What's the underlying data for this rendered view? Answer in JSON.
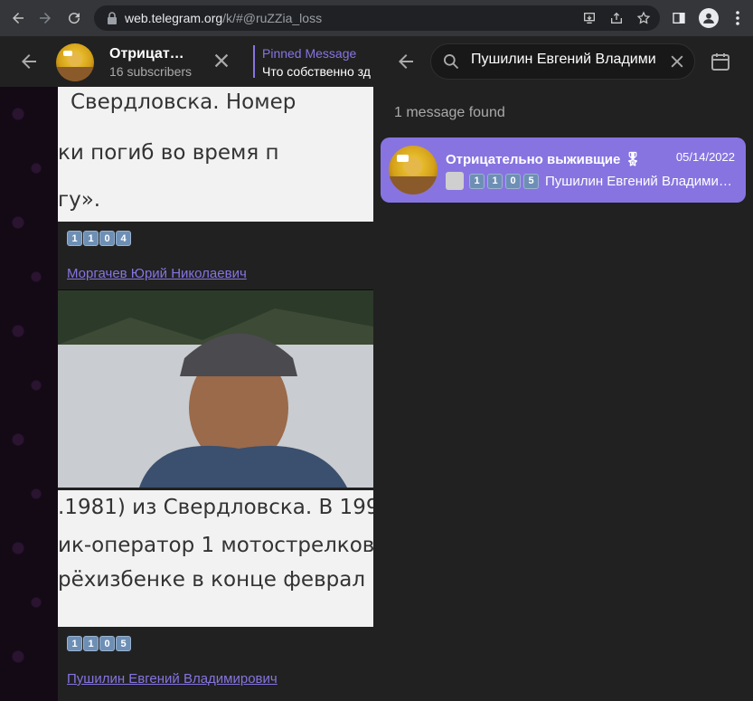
{
  "browser": {
    "url_host": "web.telegram.org",
    "url_path": "/k/#@ruZZia_loss"
  },
  "chat_header": {
    "title": "Отрицат…",
    "subscribers": "16 subscribers",
    "pinned_label": "Pinned Message",
    "pinned_text": "Что собственно зд"
  },
  "messages": [
    {
      "scan_lines": [
        "Свердловска. Номер",
        "ки погиб во время п",
        "гу»."
      ],
      "number_keys": [
        "1",
        "1",
        "0",
        "4"
      ],
      "link": "Моргачев Юрий Николаевич"
    },
    {
      "scan_lines": [
        ".1981) из Свердловска. В 199",
        "ик-оператор 1 мотострелково",
        "рёхизбенке в конце феврал"
      ],
      "number_keys": [
        "1",
        "1",
        "0",
        "5"
      ],
      "link": "Пушилин Евгений Владимирович"
    }
  ],
  "search": {
    "query": "Пушилин Евгений Владими",
    "results_count": "1 message found",
    "result": {
      "title": "Отрицательно выживщие",
      "badge": "🎖",
      "date": "05/14/2022",
      "number_keys": [
        "1",
        "1",
        "0",
        "5"
      ],
      "snippet": "Пушилин Евгений Владими…"
    }
  },
  "colors": {
    "accent": "#8774e1",
    "panel": "#212121",
    "chrome": "#35363a"
  }
}
